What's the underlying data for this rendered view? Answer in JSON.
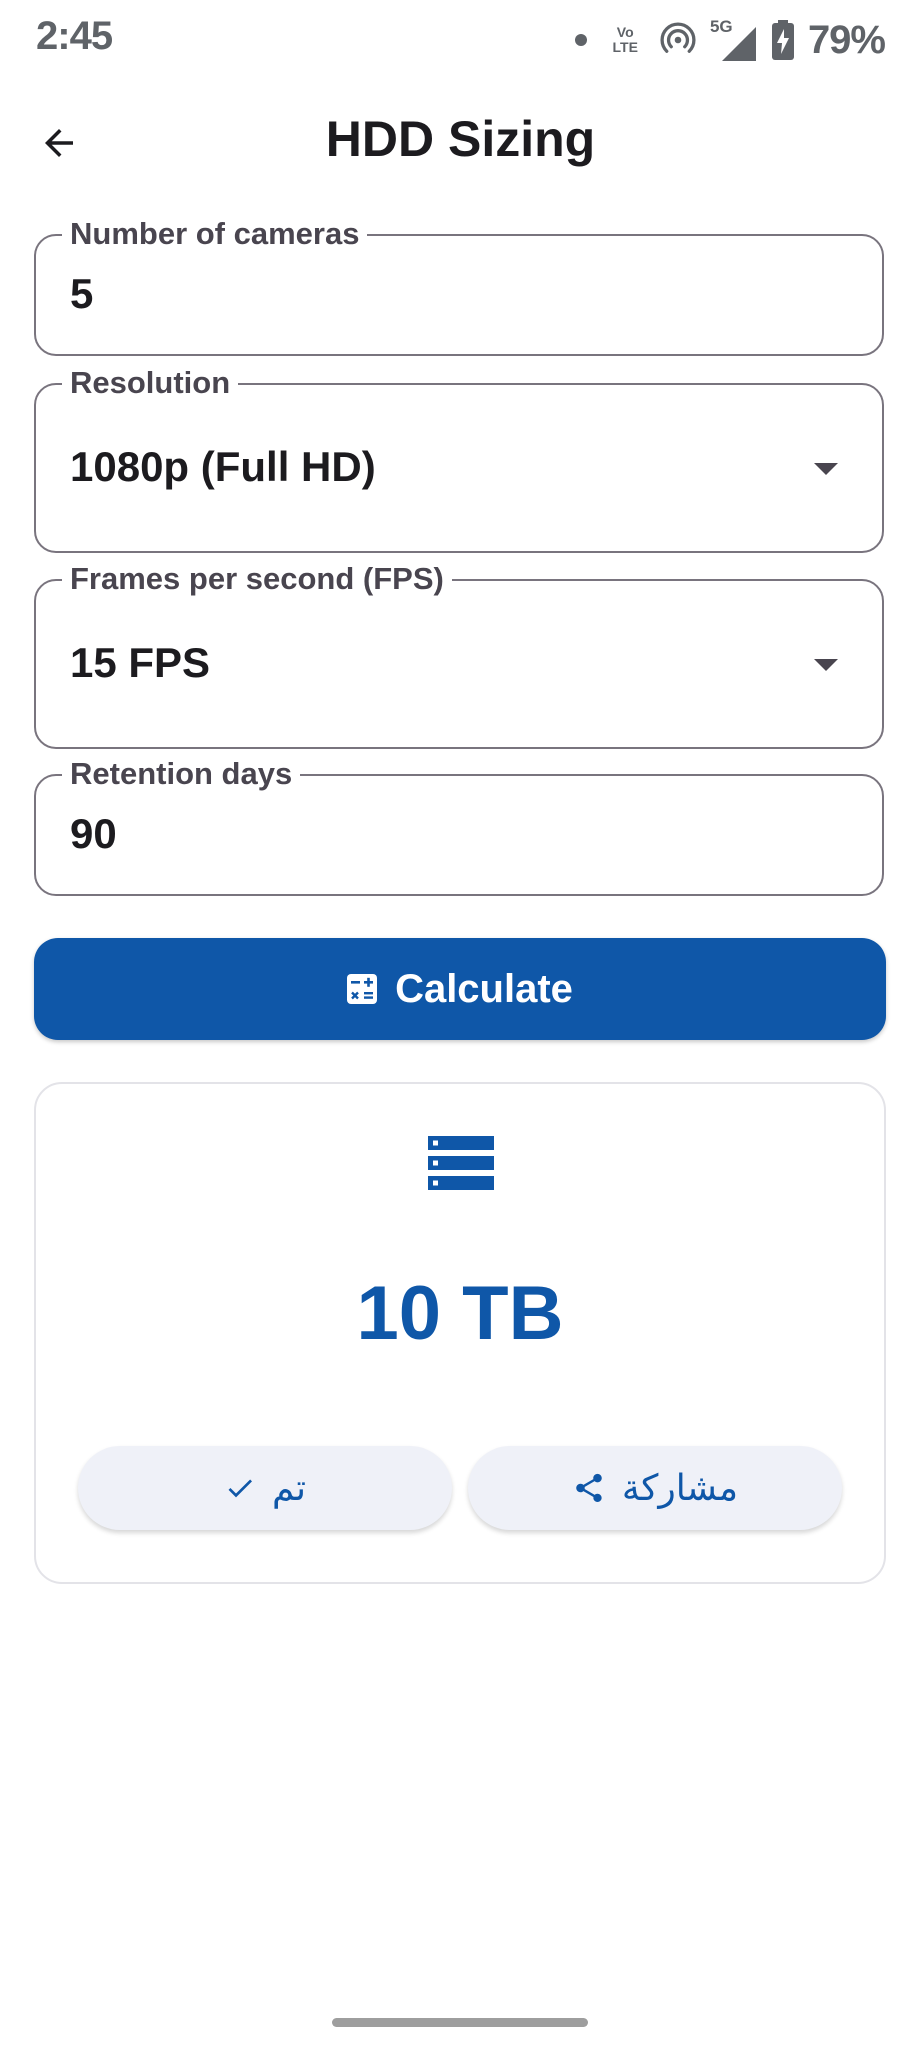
{
  "status_bar": {
    "time": "2:45",
    "volte": "Vo LTE",
    "network": "5G",
    "battery": "79%"
  },
  "app_bar": {
    "title": "HDD Sizing"
  },
  "form": {
    "cameras": {
      "label": "Number of cameras",
      "value": "5"
    },
    "resolution": {
      "label": "Resolution",
      "value": "1080p (Full HD)"
    },
    "fps": {
      "label": "Frames per second (FPS)",
      "value": "15 FPS"
    },
    "retention": {
      "label": "Retention days",
      "value": "90"
    }
  },
  "calculate_button": {
    "label": "Calculate"
  },
  "result": {
    "value": "10 TB",
    "done_label": "تم",
    "share_label": "مشاركة"
  },
  "colors": {
    "primary": "#0f57a8",
    "outline": "#79747e",
    "pill_bg": "#eff1f8"
  }
}
